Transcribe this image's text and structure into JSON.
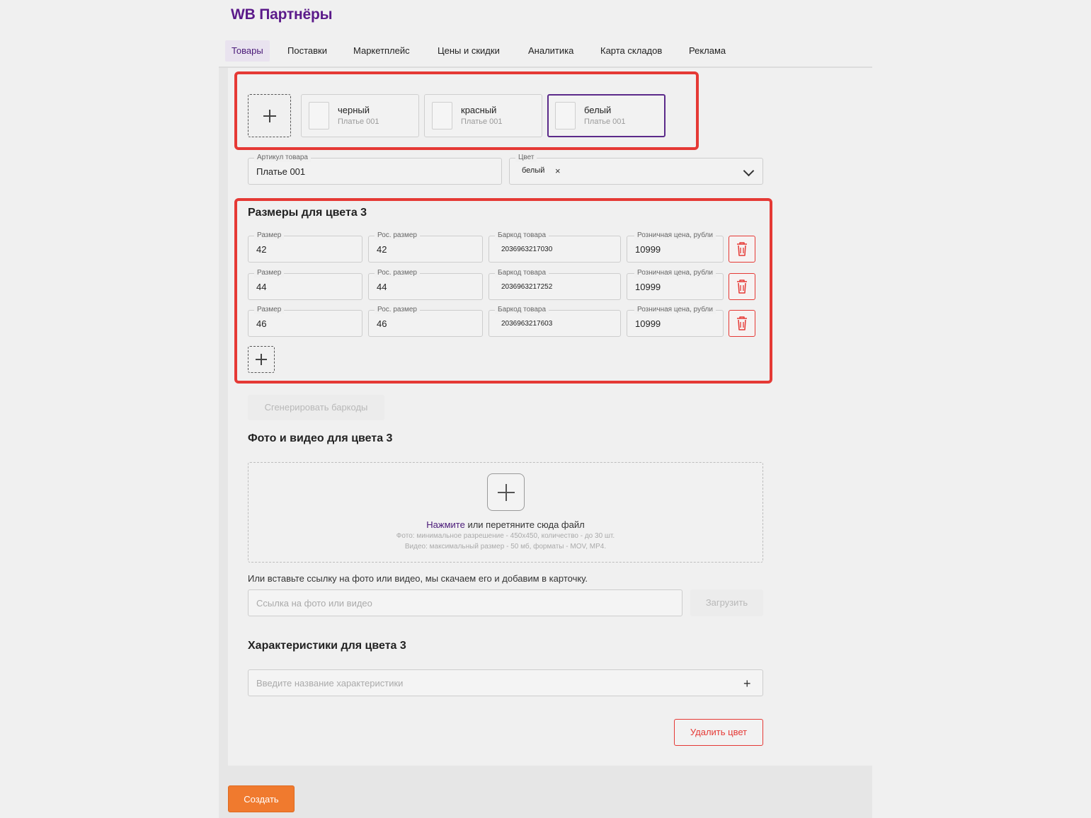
{
  "app": {
    "brand": "WB Партнёры"
  },
  "nav": {
    "items": [
      {
        "label": "Товары",
        "active": true
      },
      {
        "label": "Поставки"
      },
      {
        "label": "Маркетплейс"
      },
      {
        "label": "Цены и скидки"
      },
      {
        "label": "Аналитика"
      },
      {
        "label": "Карта складов"
      },
      {
        "label": "Реклама"
      }
    ]
  },
  "variants": [
    {
      "name": "черный",
      "article": "Платье 001"
    },
    {
      "name": "красный",
      "article": "Платье 001"
    },
    {
      "name": "белый",
      "article": "Платье 001",
      "selected": true
    }
  ],
  "article_field": {
    "label": "Артикул товара",
    "value": "Платье 001"
  },
  "color_field": {
    "label": "Цвет",
    "value": "белый",
    "remove_glyph": "×"
  },
  "sizes_section": {
    "title": "Размеры для цвета 3",
    "labels": {
      "size": "Размер",
      "ru_size": "Рос. размер",
      "barcode": "Баркод товара",
      "price": "Розничная цена, рубли"
    },
    "rows": [
      {
        "size": "42",
        "ru_size": "42",
        "barcode": "2036963217030",
        "price": "10999"
      },
      {
        "size": "44",
        "ru_size": "44",
        "barcode": "2036963217252",
        "price": "10999"
      },
      {
        "size": "46",
        "ru_size": "46",
        "barcode": "2036963217603",
        "price": "10999"
      }
    ]
  },
  "generate_barcodes_label": "Сгенерировать баркоды",
  "media_section": {
    "title": "Фото и видео для цвета 3",
    "dropzone": {
      "click_text": "Нажмите",
      "rest_text": " или перетяните сюда файл",
      "photo_hint": "Фото: минимальное разрешение - 450х450, количество - до 30 шт.",
      "video_hint": "Видео: максимальный размер - 50 мб, форматы - MOV, MP4."
    },
    "link_label": "Или вставьте ссылку на фото или видео, мы скачаем его и добавим в карточку.",
    "link_placeholder": "Ссылка на фото или видео",
    "upload_label": "Загрузить"
  },
  "characteristics_section": {
    "title": "Характеристики для цвета 3",
    "placeholder": "Введите название характеристики",
    "add_glyph": "+"
  },
  "delete_color_label": "Удалить цвет",
  "create_label": "Создать",
  "colors": {
    "brand": "#5b1a8a",
    "highlight": "#e53935",
    "primary_button": "#f07a2e"
  }
}
